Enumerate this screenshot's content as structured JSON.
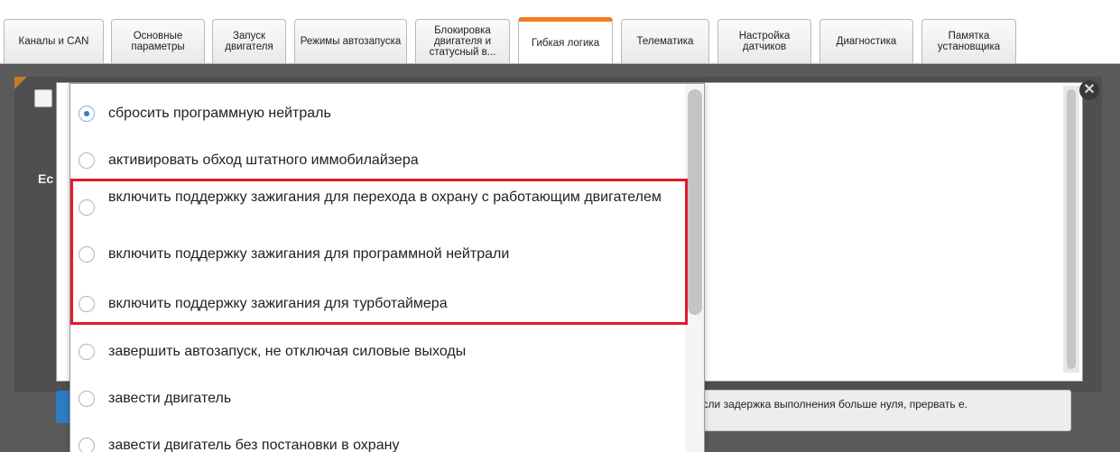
{
  "tabs": [
    {
      "label": "Каналы и CAN"
    },
    {
      "label": "Основные параметры"
    },
    {
      "label": "Запуск двигателя"
    },
    {
      "label": "Режимы автозапуска"
    },
    {
      "label": "Блокировка двигателя и статусный в..."
    },
    {
      "label": "Гибкая логика",
      "active": true
    },
    {
      "label": "Телематика"
    },
    {
      "label": "Настройка датчиков"
    },
    {
      "label": "Диагностика"
    },
    {
      "label": "Памятка установщика"
    }
  ],
  "background": {
    "left_label": "Ес",
    "info_text": ". Если задержка выполнения больше нуля, прервать е."
  },
  "dropdown": {
    "options": [
      {
        "label": "сбросить программную нейтраль",
        "selected": true
      },
      {
        "label": "активировать обход штатного иммобилайзера",
        "selected": false
      },
      {
        "label": "включить поддержку зажигания для перехода в охрану с работающим двигателем",
        "selected": false
      },
      {
        "label": "включить поддержку зажигания для программной нейтрали",
        "selected": false
      },
      {
        "label": "включить поддержку зажигания для турботаймера",
        "selected": false
      },
      {
        "label": "завершить автозапуск, не отключая силовые выходы",
        "selected": false
      },
      {
        "label": "завести двигатель",
        "selected": false
      },
      {
        "label": "завести двигатель без постановки в охрану",
        "selected": false
      }
    ]
  },
  "colors": {
    "active_tab_accent": "#f47a20",
    "highlight": "#e01a2b",
    "radio_selected": "#2f7fd3"
  }
}
